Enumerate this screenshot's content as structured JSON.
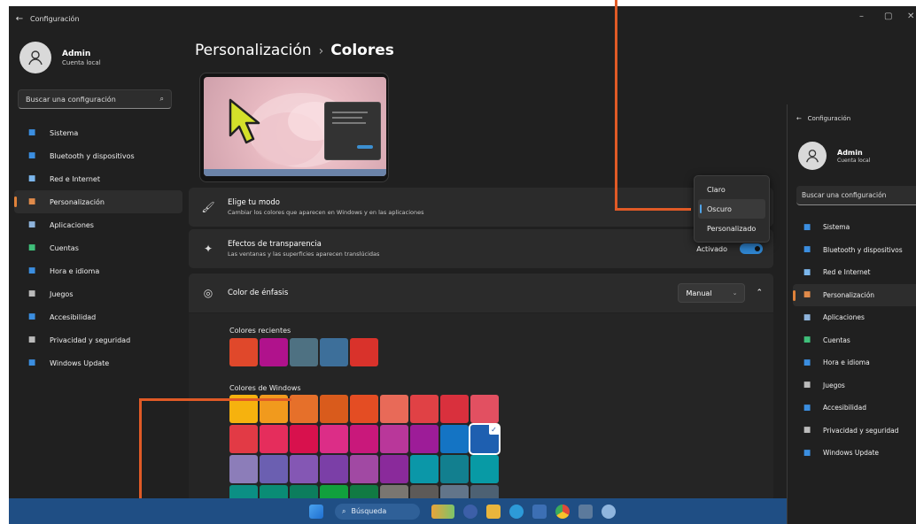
{
  "window": {
    "title": "Configuración",
    "controls": [
      "–",
      "▢",
      "✕"
    ]
  },
  "profile": {
    "name": "Admin",
    "account": "Cuenta local"
  },
  "search": {
    "placeholder": "Buscar una configuración"
  },
  "nav": [
    {
      "label": "Sistema",
      "icon": "monitor-icon",
      "color": "#3b8ee0"
    },
    {
      "label": "Bluetooth y dispositivos",
      "icon": "bluetooth-icon",
      "color": "#3b8ee0"
    },
    {
      "label": "Red e Internet",
      "icon": "wifi-icon",
      "color": "#7bb6ec"
    },
    {
      "label": "Personalización",
      "icon": "brush-icon",
      "color": "#e08a4a",
      "active": true
    },
    {
      "label": "Aplicaciones",
      "icon": "apps-icon",
      "color": "#8fb4dc"
    },
    {
      "label": "Cuentas",
      "icon": "person-icon",
      "color": "#3fbf7a"
    },
    {
      "label": "Hora e idioma",
      "icon": "globe-icon",
      "color": "#3b8ee0"
    },
    {
      "label": "Juegos",
      "icon": "controller-icon",
      "color": "#bbbbbb"
    },
    {
      "label": "Accesibilidad",
      "icon": "accessibility-icon",
      "color": "#3b8ee0"
    },
    {
      "label": "Privacidad y seguridad",
      "icon": "shield-icon",
      "color": "#bbbbbb"
    },
    {
      "label": "Windows Update",
      "icon": "update-icon",
      "color": "#3b8ee0"
    }
  ],
  "page": {
    "parent": "Personalización",
    "separator": "›",
    "current": "Colores"
  },
  "mode_card": {
    "title": "Elige tu modo",
    "description": "Cambiar los colores que aparecen en Windows y en las aplicaciones",
    "options": [
      "Claro",
      "Oscuro",
      "Personalizado"
    ],
    "selected": "Oscuro"
  },
  "transparency_card": {
    "title": "Efectos de transparencia",
    "description": "Las ventanas y las superficies aparecen translúcidas",
    "state": "Activado",
    "on": true
  },
  "accent_card": {
    "title": "Color de énfasis",
    "select_value": "Manual",
    "recent_label": "Colores recientes",
    "recent": [
      "#e0482b",
      "#b0128c",
      "#4e7182",
      "#3d6f9a",
      "#d9322b"
    ],
    "windows_label": "Colores de Windows",
    "windows_colors": [
      [
        "#f6b20e",
        "#f19a1d",
        "#e6702a",
        "#d95b1c",
        "#e44d23",
        "#e86a58",
        "#e04145",
        "#d9303d",
        "#e25061"
      ],
      [
        "#e23a45",
        "#e52d5c",
        "#d8114d",
        "#dc2d87",
        "#c9187b",
        "#b9379a",
        "#9d1c98",
        "#1474c4",
        "#1e5fb0"
      ],
      [
        "#8c7db9",
        "#6b5fb1",
        "#8457b4",
        "#7b3fa7",
        "#a149a3",
        "#8a2a9b",
        "#0b97a8",
        "#127f8f",
        "#089aa5"
      ],
      [
        "#0b8f84",
        "#0a8c75",
        "#0c7d5d",
        "#11a03d",
        "#117a43",
        "#7a7671",
        "#5d5a58",
        "#62758a",
        "#4d6173"
      ]
    ],
    "selected_color": "#1e5fb0"
  },
  "taskbar": {
    "search_label": "Búsqueda"
  },
  "second_window": {
    "title": "Configuración"
  }
}
